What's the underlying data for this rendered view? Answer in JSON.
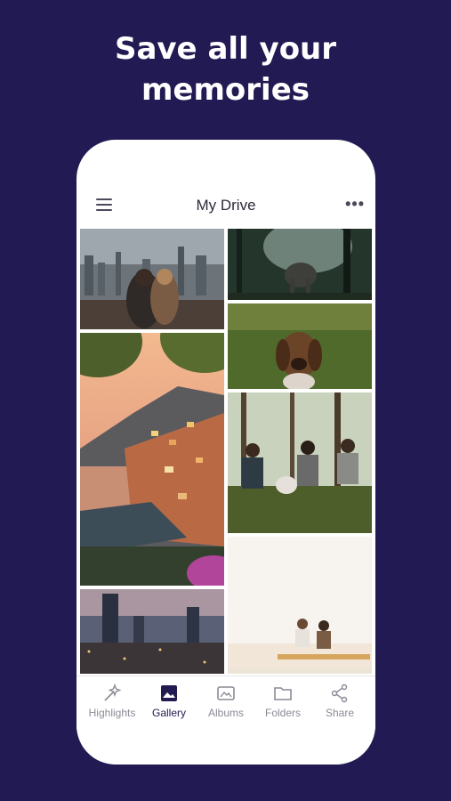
{
  "headline": {
    "line1": "Save all your",
    "line2": "memories"
  },
  "app": {
    "title": "My Drive"
  },
  "photos": [
    {
      "name": "photo-couple-city"
    },
    {
      "name": "photo-elephant-forest"
    },
    {
      "name": "photo-dog-grass"
    },
    {
      "name": "photo-coastal-village"
    },
    {
      "name": "photo-friends-picnic"
    },
    {
      "name": "photo-city-night"
    },
    {
      "name": "photo-two-people-sunset"
    }
  ],
  "tabs": [
    {
      "label": "Highlights",
      "icon": "sparkle-icon",
      "active": false
    },
    {
      "label": "Gallery",
      "icon": "gallery-icon",
      "active": true
    },
    {
      "label": "Albums",
      "icon": "albums-icon",
      "active": false
    },
    {
      "label": "Folders",
      "icon": "folder-icon",
      "active": false
    },
    {
      "label": "Share",
      "icon": "share-icon",
      "active": false
    }
  ],
  "colors": {
    "background": "#221a52",
    "accent": "#221a52",
    "inactive": "#8a8a96"
  }
}
